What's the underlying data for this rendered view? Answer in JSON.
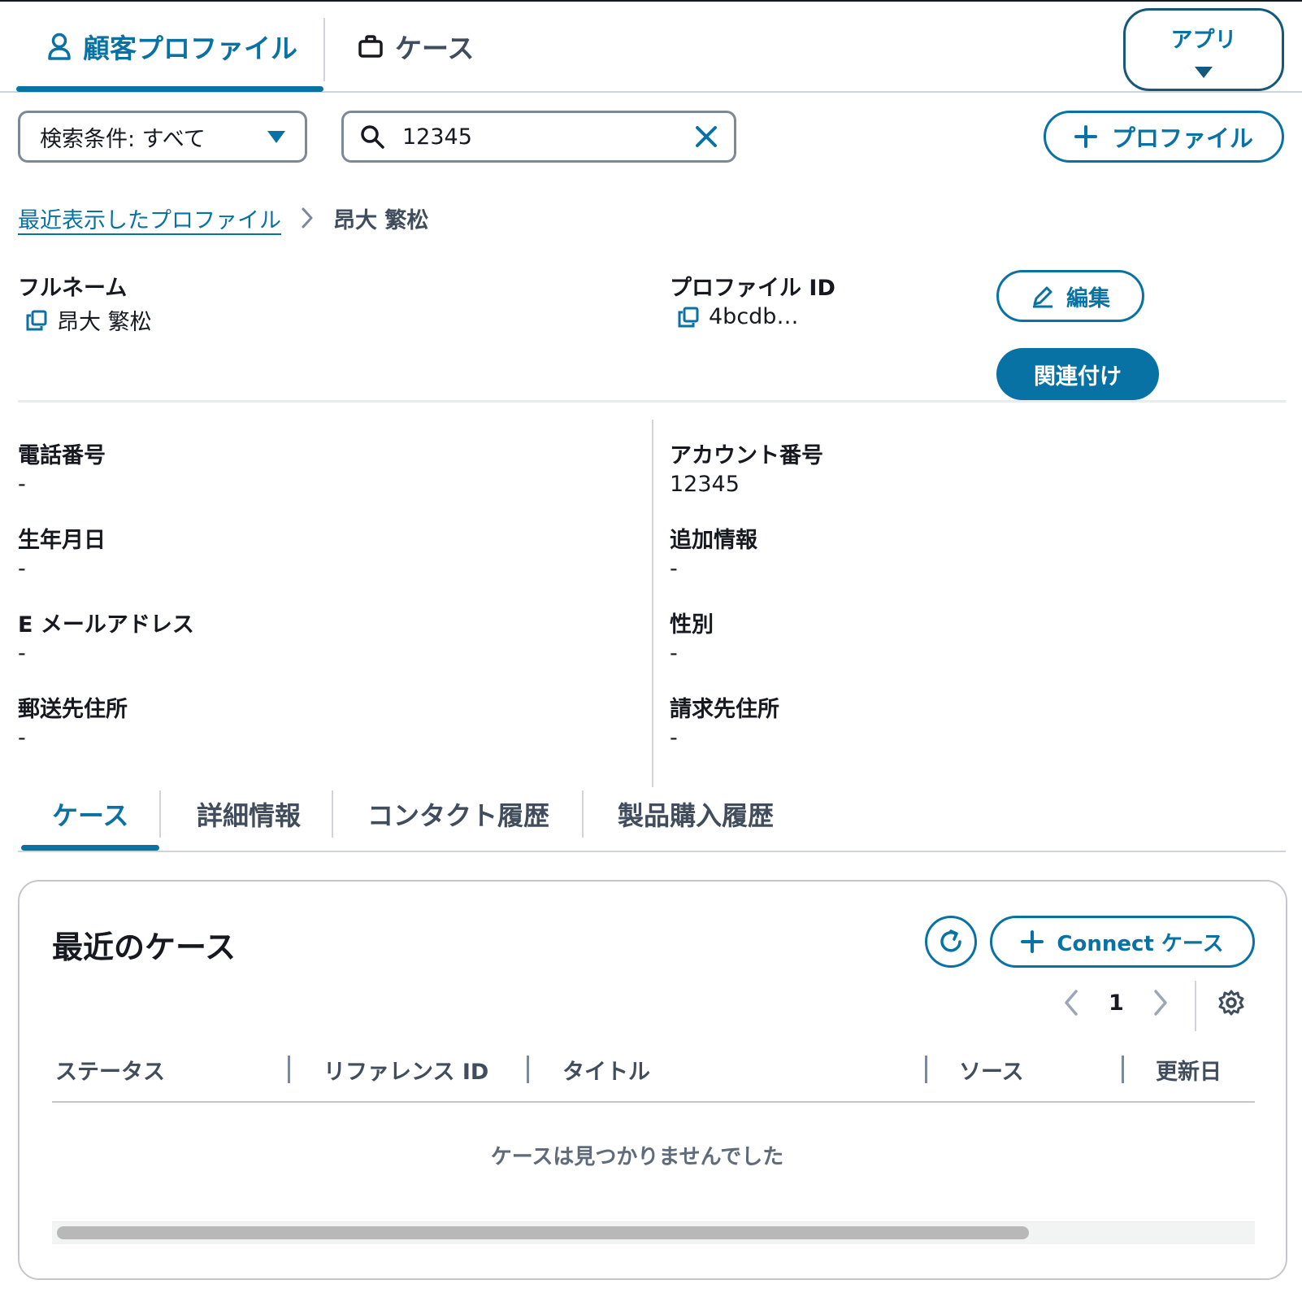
{
  "top_tabs": {
    "customer_profile": "顧客プロファイル",
    "cases": "ケース"
  },
  "apps_button": "アプリ",
  "search": {
    "filter_label": "検索条件: すべて",
    "query": "12345",
    "add_profile_label": "プロファイル"
  },
  "breadcrumb": {
    "link": "最近表示したプロファイル",
    "current": "昂大 繁松"
  },
  "profile": {
    "full_name_label": "フルネーム",
    "full_name": "昂大 繁松",
    "profile_id_label": "プロファイル ID",
    "profile_id": "4bcdb…",
    "edit_label": "編集",
    "associate_label": "関連付け"
  },
  "fields_left": [
    {
      "label": "電話番号",
      "value": "-"
    },
    {
      "label": "生年月日",
      "value": "-"
    },
    {
      "label": "E メールアドレス",
      "value": "-"
    },
    {
      "label": "郵送先住所",
      "value": "-"
    }
  ],
  "fields_right": [
    {
      "label": "アカウント番号",
      "value": "12345"
    },
    {
      "label": "追加情報",
      "value": "-"
    },
    {
      "label": "性別",
      "value": "-"
    },
    {
      "label": "請求先住所",
      "value": "-"
    }
  ],
  "inner_tabs": [
    "ケース",
    "詳細情報",
    "コンタクト履歴",
    "製品購入履歴"
  ],
  "cases_panel": {
    "title": "最近のケース",
    "connect_case_label": "Connect ケース",
    "page": "1",
    "columns": [
      "ステータス",
      "リファレンス ID",
      "タイトル",
      "ソース",
      "更新日"
    ],
    "empty_message": "ケースは見つかりませんでした"
  },
  "colors": {
    "accent": "#0972a5",
    "text": "#16191f",
    "muted": "#414d5c",
    "border": "#7d8998"
  }
}
